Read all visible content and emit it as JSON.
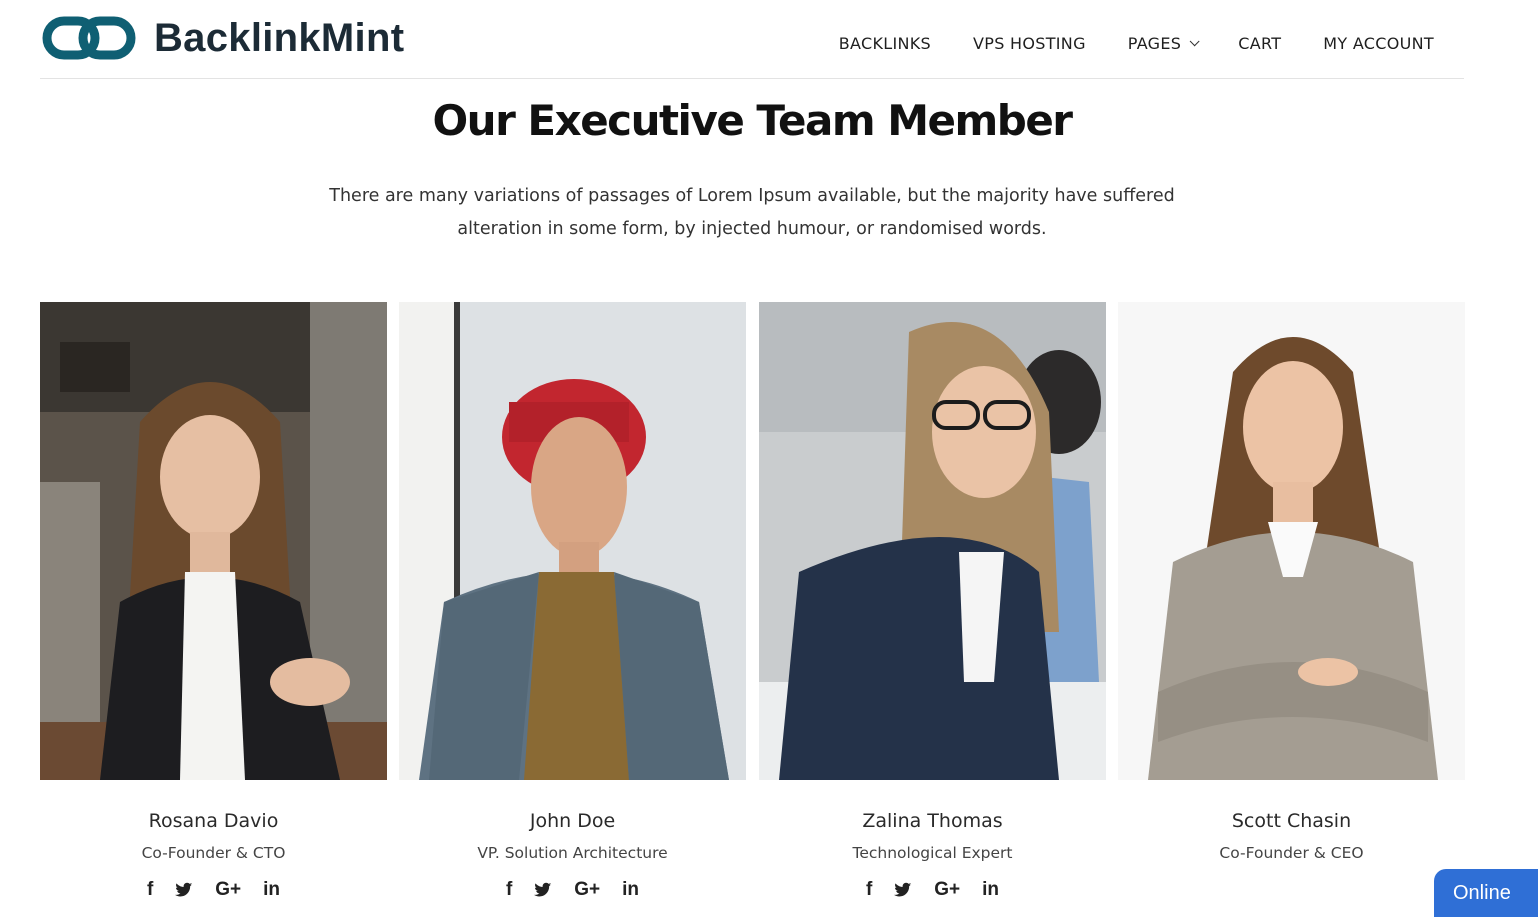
{
  "brand": {
    "name": "BacklinkMint",
    "color": "#0f5f73"
  },
  "nav": {
    "items": [
      {
        "label": "BACKLINKS"
      },
      {
        "label": "VPS HOSTING"
      },
      {
        "label": "PAGES",
        "has_dropdown": true
      },
      {
        "label": "CART"
      },
      {
        "label": "MY ACCOUNT"
      }
    ]
  },
  "section": {
    "title": "Our Executive Team Member",
    "description": "There are many variations of passages of Lorem Ipsum available, but the majority have suffered alteration in some form, by injected humour, or randomised words."
  },
  "team": [
    {
      "name": "Rosana Davio",
      "role": "Co-Founder & CTO"
    },
    {
      "name": "John Doe",
      "role": "VP. Solution Architecture"
    },
    {
      "name": "Zalina Thomas",
      "role": "Technological Expert"
    },
    {
      "name": "Scott Chasin",
      "role": "Co-Founder & CEO"
    }
  ],
  "social_icons": [
    "facebook-icon",
    "twitter-icon",
    "google-plus-icon",
    "linkedin-icon"
  ],
  "social_glyphs": {
    "facebook": "f",
    "google": "G+",
    "linkedin": "in"
  },
  "chat": {
    "label": "Online",
    "color": "#2f6fd6"
  }
}
